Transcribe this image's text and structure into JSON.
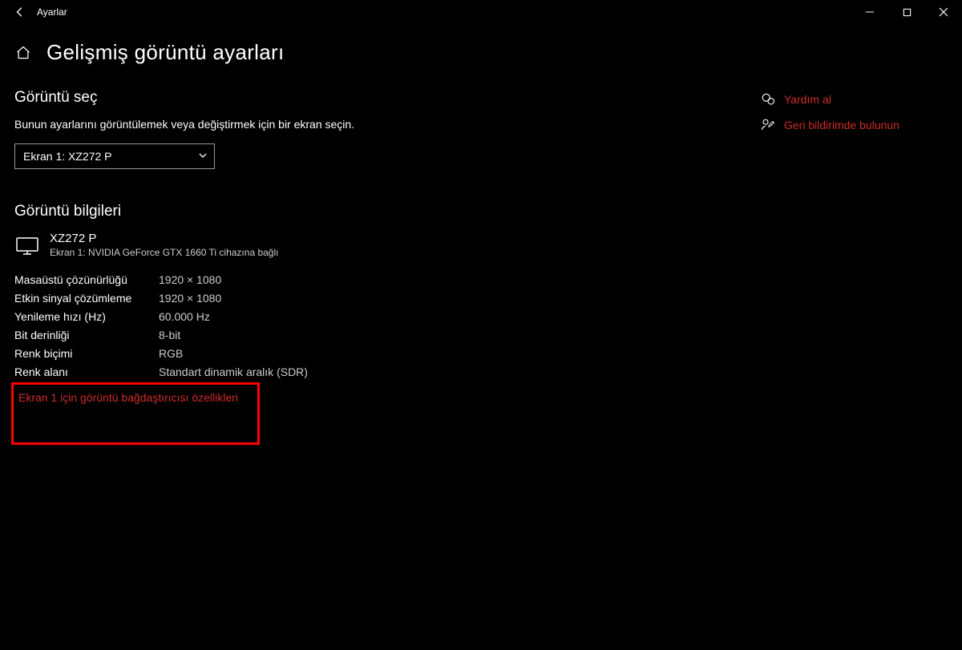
{
  "window": {
    "title": "Ayarlar"
  },
  "page": {
    "title": "Gelişmiş görüntü ayarları"
  },
  "select_display": {
    "title": "Görüntü seç",
    "description": "Bunun ayarlarını görüntülemek veya değiştirmek için bir ekran seçin.",
    "selected": "Ekran 1: XZ272 P"
  },
  "display_info": {
    "title": "Görüntü bilgileri",
    "name": "XZ272 P",
    "connected_to": "Ekran 1: NVIDIA GeForce GTX 1660 Ti cihazına bağlı",
    "rows": [
      {
        "key": "Masaüstü çözünürlüğü",
        "val": "1920 × 1080"
      },
      {
        "key": "Etkin sinyal çözümleme",
        "val": "1920 × 1080"
      },
      {
        "key": "Yenileme hızı (Hz)",
        "val": "60.000 Hz"
      },
      {
        "key": "Bit derinliği",
        "val": "8-bit"
      },
      {
        "key": "Renk biçimi",
        "val": "RGB"
      },
      {
        "key": "Renk alanı",
        "val": "Standart dinamik aralık (SDR)"
      }
    ],
    "adapter_link": "Ekran 1 için görüntü bağdaştırıcısı özellikleri"
  },
  "side": {
    "help": "Yardım al",
    "feedback": "Geri bildirimde bulunun"
  }
}
